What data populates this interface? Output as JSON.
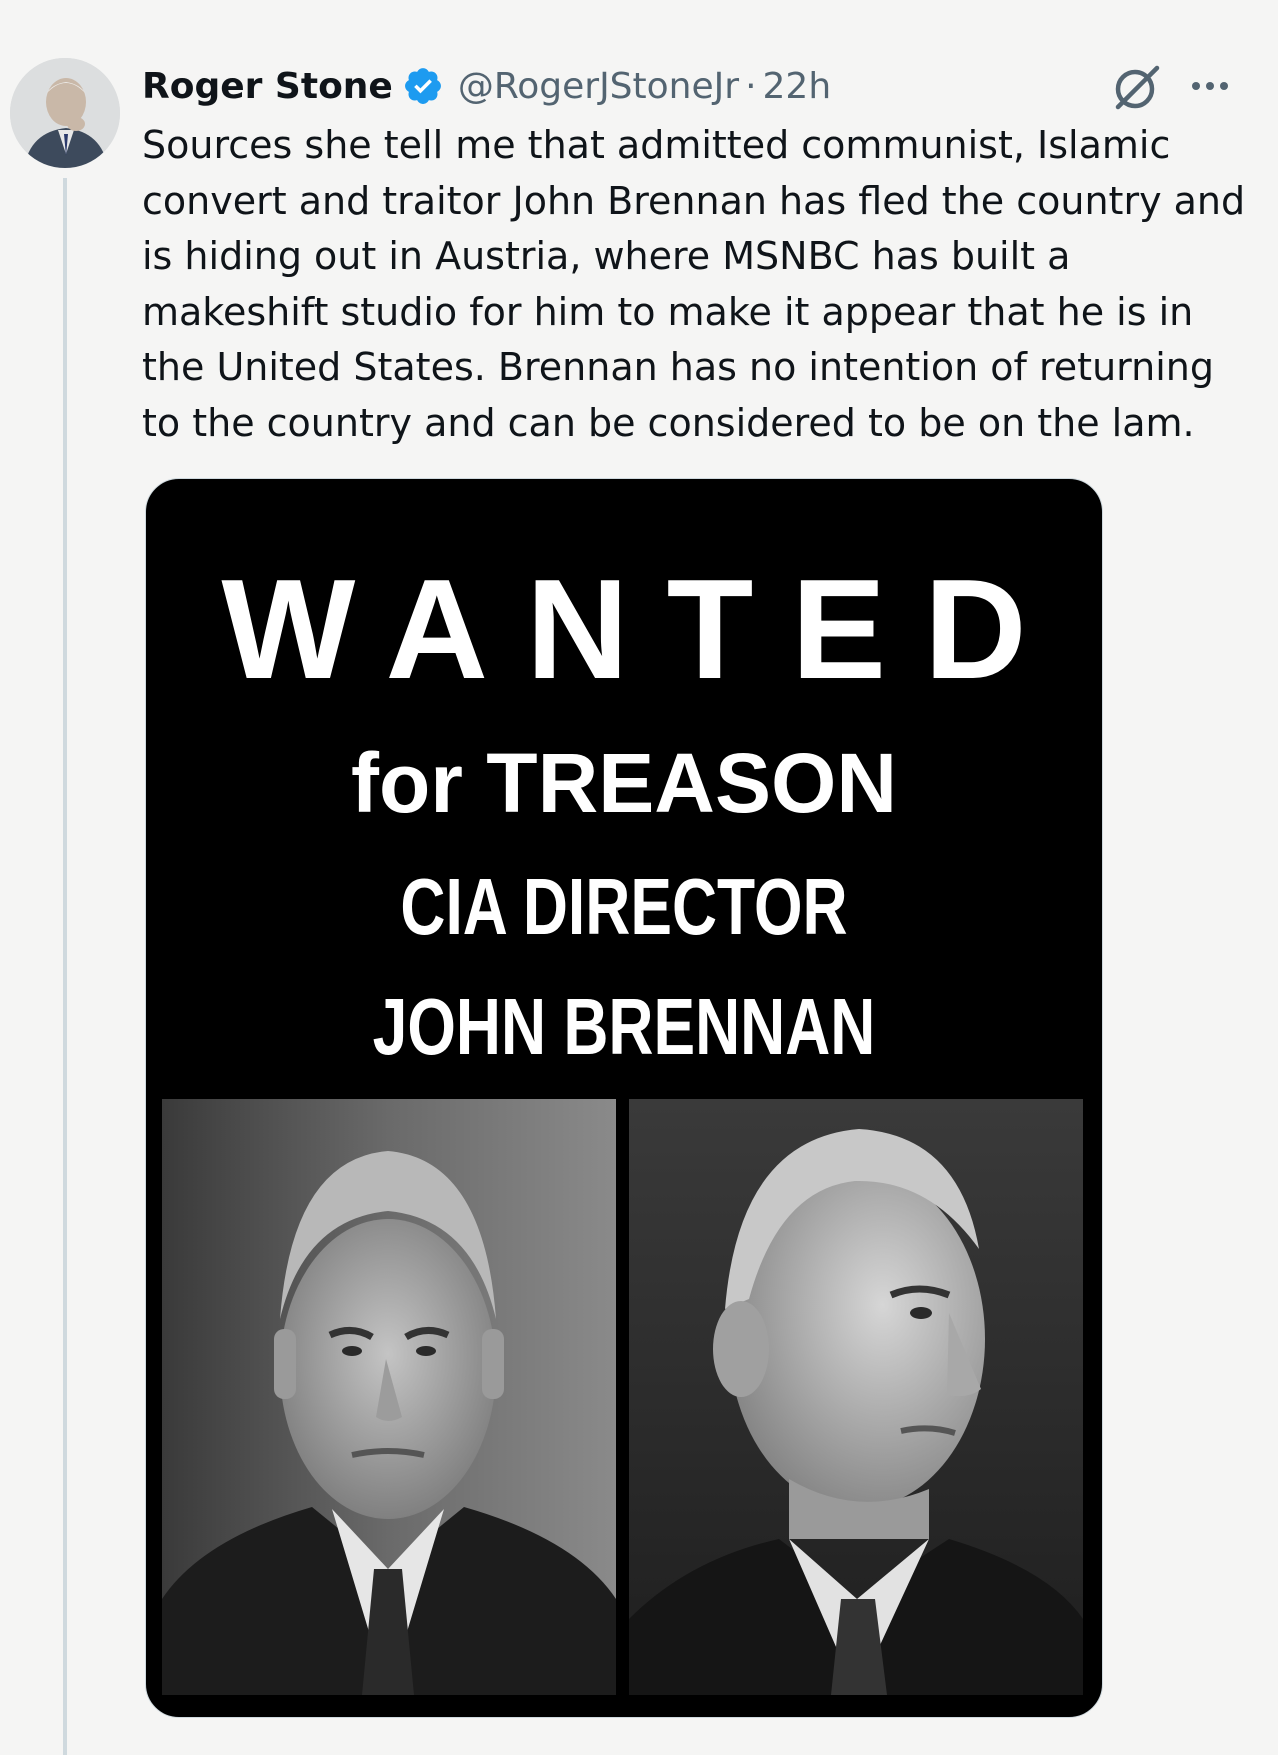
{
  "author": {
    "name": "Roger Stone",
    "handle": "@RogerJStoneJr",
    "separator": "·",
    "time": "22h",
    "avatar_icon": "avatar-photo",
    "verified_icon": "verified-badge-icon"
  },
  "actions": {
    "grok_icon": "grok-icon",
    "more_icon": "more-options-icon"
  },
  "tweet": {
    "text": "Sources she tell me that admitted communist, Islamic\nconvert and traitor John Brennan has fled the country and\nis hiding out in Austria, where MSNBC has built a\nmakeshift studio for him to make it appear that he is in\nthe United States. Brennan has no intention of returning\nto the country and can be considered to be on the lam."
  },
  "media": {
    "headline": "WANTED",
    "subhead": "for TREASON",
    "line1": "CIA DIRECTOR",
    "line2": "JOHN BRENNAN"
  },
  "colors": {
    "background": "#f5f5f4",
    "verified_blue": "#1d9bf0",
    "secondary_text": "#536471",
    "poster_black": "#000000"
  }
}
